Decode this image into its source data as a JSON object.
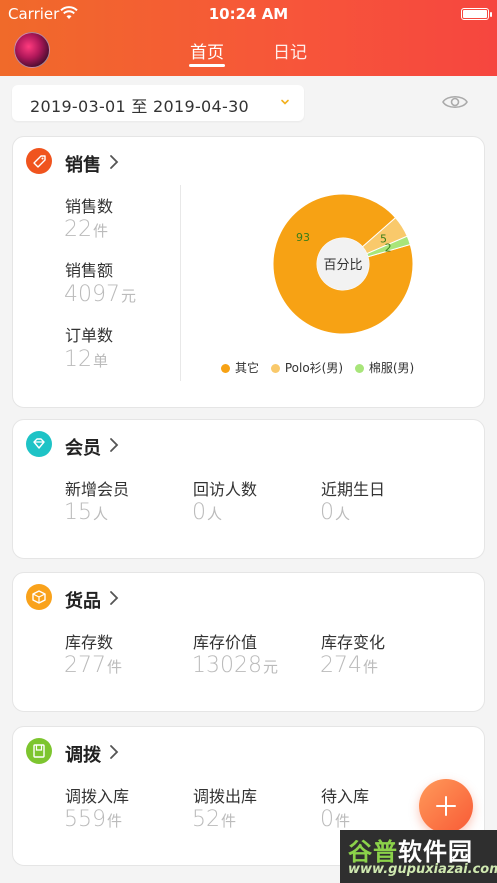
{
  "status_bar": {
    "carrier": "Carrier",
    "time": "10:24 AM"
  },
  "header": {
    "tabs": [
      {
        "label": "首页",
        "active": true
      },
      {
        "label": "日记",
        "active": false
      }
    ]
  },
  "date_range": {
    "text": "2019-03-01 至 2019-04-30"
  },
  "sales": {
    "title": "销售",
    "stats": [
      {
        "label": "销售数",
        "value": "22",
        "unit": "件"
      },
      {
        "label": "销售额",
        "value": "4097",
        "unit": "元"
      },
      {
        "label": "订单数",
        "value": "12",
        "unit": "单"
      }
    ]
  },
  "chart_data": {
    "type": "pie",
    "center_label": "百分比",
    "categories": [
      "其它",
      "Polo衫(男)",
      "棉服(男)"
    ],
    "values": [
      93,
      5,
      2
    ],
    "colors": [
      "#f7a214",
      "#f9c96b",
      "#a8e57a"
    ]
  },
  "members": {
    "title": "会员",
    "stats": [
      {
        "label": "新增会员",
        "value": "15",
        "unit": "人"
      },
      {
        "label": "回访人数",
        "value": "0",
        "unit": "人"
      },
      {
        "label": "近期生日",
        "value": "0",
        "unit": "人"
      }
    ]
  },
  "goods": {
    "title": "货品",
    "stats": [
      {
        "label": "库存数",
        "value": "277",
        "unit": "件"
      },
      {
        "label": "库存价值",
        "value": "13028",
        "unit": "元"
      },
      {
        "label": "库存变化",
        "value": "274",
        "unit": "件"
      }
    ]
  },
  "transfer": {
    "title": "调拨",
    "stats": [
      {
        "label": "调拨入库",
        "value": "559",
        "unit": "件"
      },
      {
        "label": "调拨出库",
        "value": "52",
        "unit": "件"
      },
      {
        "label": "待入库",
        "value": "0",
        "unit": "件"
      }
    ]
  },
  "watermark": {
    "text_cn_1": "谷普",
    "text_cn_2": "软件园",
    "text_en": "www.gupuxiazai.com"
  },
  "colors": {
    "accent": "#f7553a",
    "sales_icon": "#f0541e",
    "members_icon": "#1ec3c6",
    "goods_icon": "#f9a21b",
    "transfer_icon": "#7dc52f"
  },
  "icons": [
    "wifi-icon",
    "battery-icon",
    "avatar",
    "chevron-down-icon",
    "eye-icon",
    "tag-icon",
    "diamond-icon",
    "box-icon",
    "tray-icon",
    "chevron-right-icon",
    "plus-icon"
  ]
}
